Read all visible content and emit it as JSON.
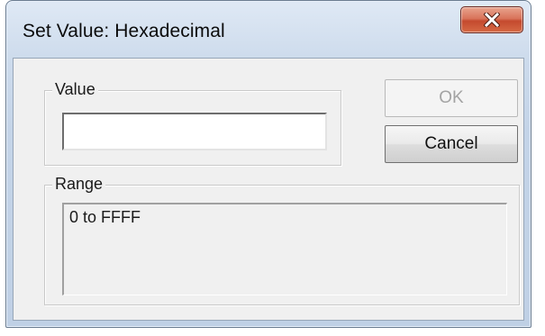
{
  "window": {
    "title": "Set Value: Hexadecimal",
    "close_icon": "close-icon"
  },
  "value_group": {
    "legend": "Value",
    "input_value": "",
    "input_placeholder": ""
  },
  "buttons": {
    "ok_label": "OK",
    "ok_enabled": false,
    "cancel_label": "Cancel"
  },
  "range_group": {
    "legend": "Range",
    "text": "0 to FFFF"
  },
  "colors": {
    "close_button": "#c9553a",
    "dialog_background": "#f0f0f0",
    "frame": "#c4d4e8"
  }
}
